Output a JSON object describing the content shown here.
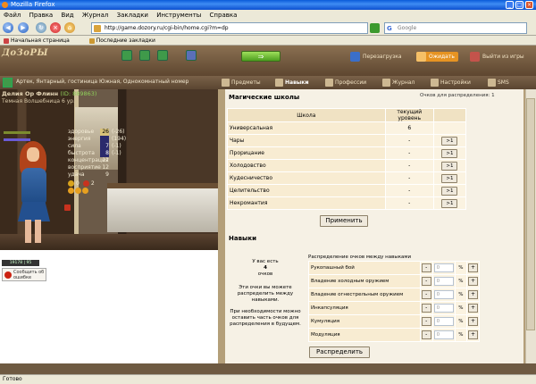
{
  "window": {
    "title": "Mozilla Firefox"
  },
  "menu": [
    "Файл",
    "Правка",
    "Вид",
    "Журнал",
    "Закладки",
    "Инструменты",
    "Справка"
  ],
  "address": {
    "url": "http://game.dozory.ru/cgi-bin/home.cgi?m=dp"
  },
  "search": {
    "engine": "G",
    "placeholder": "Google"
  },
  "bookmarks": [
    "Начальная страница",
    "Последние закладки"
  ],
  "header": {
    "logo": "ДоЗоРЫ",
    "goto_button": "⇒",
    "buttons": [
      "Перезагрузка",
      "Ожидать",
      "Выйти из игры"
    ]
  },
  "location": {
    "text": "Артек, Янтарный, гостиница Южная, Однокомнатный номер",
    "tabs": [
      "Предметы",
      "Навыки",
      "Профессии",
      "Журнал",
      "Настройки",
      "SMS"
    ],
    "active_tab": "Навыки"
  },
  "player": {
    "name": "Делия Ор Флинн",
    "id": "(ID: 889863)",
    "subtitle": "Темная Волшебница 6 ур.",
    "stats": [
      {
        "label": "здоровье",
        "value": "26",
        "extra": "(-26)",
        "style": "hl"
      },
      {
        "label": "энергия",
        "value": "",
        "extra": "(194)",
        "style": "hb"
      },
      {
        "label": "сила",
        "value": "7",
        "extra": "(-1)",
        "style": ""
      },
      {
        "label": "быстрота",
        "value": "8",
        "extra": "(-1)",
        "style": ""
      },
      {
        "label": "концентрация",
        "value": "12",
        "extra": "",
        "style": ""
      },
      {
        "label": "восприятие",
        "value": "12",
        "extra": "",
        "style": ""
      },
      {
        "label": "удача",
        "value": "9",
        "extra": "",
        "style": ""
      }
    ],
    "badges": [
      "0",
      "2"
    ],
    "counter": "19178 | 95",
    "report": "Сообщить об ошибке"
  },
  "magic": {
    "title": "Магические школы",
    "points_label": "Очков для распределения: 1",
    "col_school": "Школа",
    "col_level": "текущий уровень",
    "schools": [
      {
        "name": "Универсальная",
        "level": "6",
        "btn": ""
      },
      {
        "name": "Чары",
        "level": "-",
        "btn": ">1"
      },
      {
        "name": "Прорицание",
        "level": "-",
        "btn": ">1"
      },
      {
        "name": "Холодовство",
        "level": "-",
        "btn": ">1"
      },
      {
        "name": "Кудесничество",
        "level": "-",
        "btn": ">1"
      },
      {
        "name": "Целительство",
        "level": "-",
        "btn": ">1"
      },
      {
        "name": "Некромантия",
        "level": "-",
        "btn": ">1"
      }
    ],
    "apply": "Применить"
  },
  "skills": {
    "title": "Навыки",
    "note1": "У вас есть",
    "note_points": "4",
    "note2": "очков",
    "note3": "Эти очки вы можете распределить между навыками.",
    "note4": "При необходимости можно оставить часть очков для распределения в будущем.",
    "dist_title": "Распределение очков между навыками",
    "items": [
      {
        "name": "Рукопашный бой",
        "value": "0"
      },
      {
        "name": "Владение холодным оружием",
        "value": "0"
      },
      {
        "name": "Владение огнестрельным оружием",
        "value": "0"
      },
      {
        "name": "Инкапсуляция",
        "value": "0"
      },
      {
        "name": "Кумуляция",
        "value": "0"
      },
      {
        "name": "Модуляция",
        "value": "0"
      }
    ],
    "minus": "-",
    "plus": "+",
    "pct": "%",
    "distribute": "Распределить"
  },
  "status": {
    "text": "Готово"
  },
  "colors": {
    "accent": "#5e4630",
    "panel": "#f6f1e5",
    "title_blue": "#0a5bd9"
  }
}
